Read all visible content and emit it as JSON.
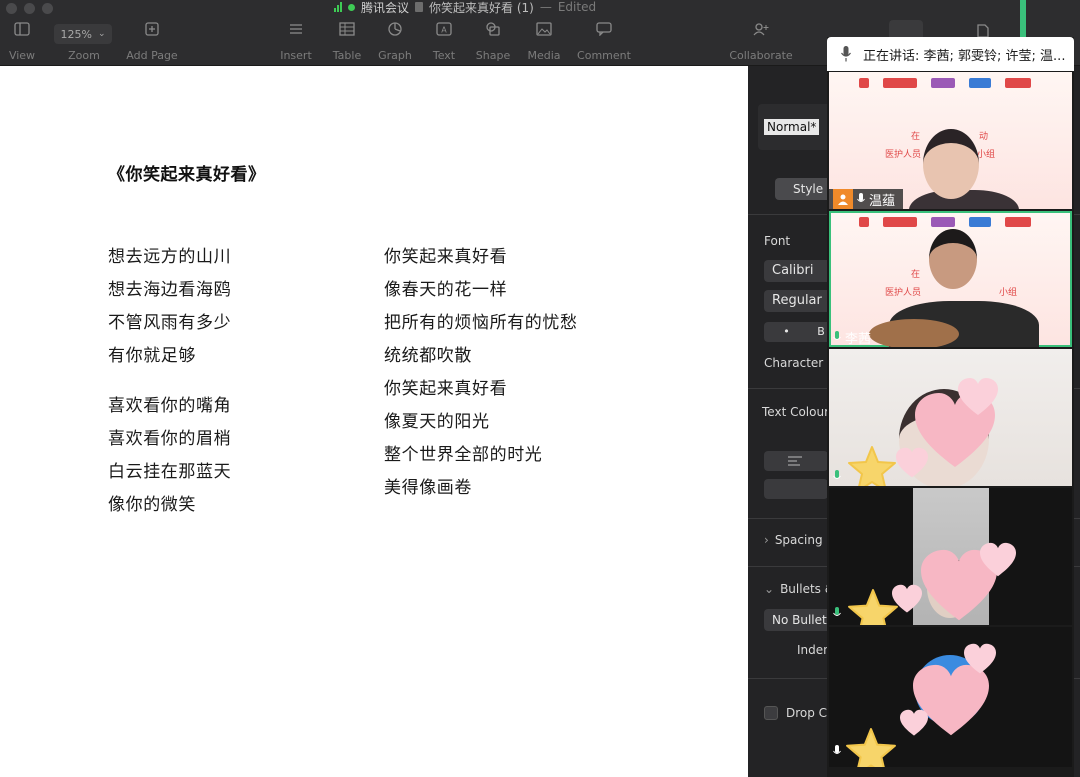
{
  "window": {
    "app_name": "腾讯会议",
    "doc_title": "你笑起来真好看 (1)",
    "separator": "—",
    "status": "Edited"
  },
  "toolbar": {
    "zoom_value": "125%",
    "items": [
      {
        "label": "View",
        "icon": "sidebar-icon"
      },
      {
        "label": "Zoom",
        "icon": "zoom-icon"
      },
      {
        "label": "Add Page",
        "icon": "add-page-icon"
      },
      {
        "label": "Insert",
        "icon": "insert-icon"
      },
      {
        "label": "Table",
        "icon": "table-icon"
      },
      {
        "label": "Graph",
        "icon": "graph-icon"
      },
      {
        "label": "Text",
        "icon": "text-icon"
      },
      {
        "label": "Shape",
        "icon": "shape-icon"
      },
      {
        "label": "Media",
        "icon": "media-icon"
      },
      {
        "label": "Comment",
        "icon": "comment-icon"
      },
      {
        "label": "Collaborate",
        "icon": "collaborate-icon"
      }
    ]
  },
  "document": {
    "heading": "《你笑起来真好看》",
    "left_column": [
      "想去远方的山川",
      "想去海边看海鸥",
      "不管风雨有多少",
      "有你就足够",
      "喜欢看你的嘴角",
      "喜欢看你的眉梢",
      "白云挂在那蓝天",
      "像你的微笑"
    ],
    "right_column": [
      "你笑起来真好看",
      "像春天的花一样",
      "把所有的烦恼所有的忧愁",
      "统统都吹散",
      "你笑起来真好看",
      "像夏天的阳光",
      "整个世界全部的时光",
      "美得像画卷"
    ]
  },
  "inspector": {
    "paragraph_style": "Normal*",
    "style_tab": "Style",
    "font_label": "Font",
    "font_family": "Calibri",
    "font_weight": "Regular",
    "bold_label": "B",
    "bullet_symbol": "•",
    "character_styles_label": "Character S",
    "text_colour_label": "Text Colour",
    "spacing_label": "Spacing",
    "bullets_label": "Bullets &",
    "no_bullets": "No Bullets",
    "indent_label": "Inden",
    "drop_cap_label": "Drop C"
  },
  "meeting": {
    "speaking_now": "正在讲话: 李茜; 郭雯铃; 许莹; 温...",
    "participants": [
      {
        "name": "温蕴",
        "video": "banner"
      },
      {
        "name": "李茜",
        "video": "banner"
      },
      {
        "name": "",
        "video": "camera"
      },
      {
        "name": "",
        "video": "camera"
      },
      {
        "name": "",
        "video": "camera"
      }
    ],
    "accent_color": "#3ac07b"
  }
}
